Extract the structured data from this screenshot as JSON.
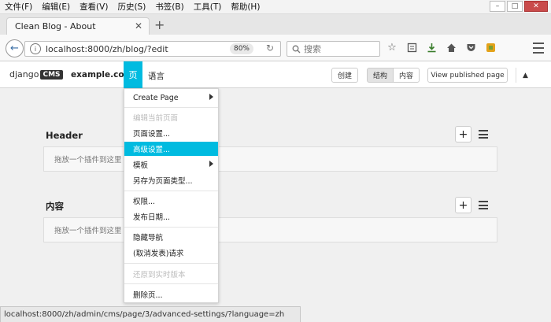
{
  "browser": {
    "menu": [
      "文件(F)",
      "编辑(E)",
      "查看(V)",
      "历史(S)",
      "书签(B)",
      "工具(T)",
      "帮助(H)"
    ],
    "window_controls": {
      "minimize": "–",
      "maximize": "□",
      "close": "✕"
    },
    "tab_title": "Clean Blog - About",
    "url": "localhost:8000/zh/blog/?edit",
    "zoom": "80%",
    "search_placeholder": "搜索",
    "status_url": "localhost:8000/zh/admin/cms/page/3/advanced-settings/?language=zh"
  },
  "cms_toolbar": {
    "logo_text": "django",
    "logo_badge": "CMS",
    "site": "example.com",
    "page_menu": "页",
    "language_menu": "语言",
    "create": "创建",
    "structure": "结构",
    "content": "内容",
    "view_published": "View published page"
  },
  "placeholders": [
    {
      "title": "Header",
      "drop_text": "拖放一个插件到这里"
    },
    {
      "title": "内容",
      "drop_text": "拖放一个插件到这里"
    }
  ],
  "page_menu_items": [
    {
      "label": "Create Page",
      "state": "normal",
      "submenu": true
    },
    {
      "label": "编辑当前页面",
      "state": "disabled",
      "submenu": false
    },
    {
      "label": "页面设置...",
      "state": "normal",
      "submenu": false
    },
    {
      "label": "高级设置...",
      "state": "active",
      "submenu": false
    },
    {
      "label": "模板",
      "state": "normal",
      "submenu": true
    },
    {
      "label": "另存为页面类型...",
      "state": "normal",
      "submenu": false
    },
    {
      "label": "权限...",
      "state": "normal",
      "submenu": false
    },
    {
      "label": "发布日期...",
      "state": "normal",
      "submenu": false
    },
    {
      "label": "隐藏导航",
      "state": "normal",
      "submenu": false
    },
    {
      "label": "(取消发表)请求",
      "state": "normal",
      "submenu": false
    },
    {
      "label": "还原到实时版本",
      "state": "disabled",
      "submenu": false
    },
    {
      "label": "删除页...",
      "state": "normal",
      "submenu": false
    }
  ],
  "colors": {
    "accent": "#00bbe0",
    "close_button": "#c94b4b"
  }
}
